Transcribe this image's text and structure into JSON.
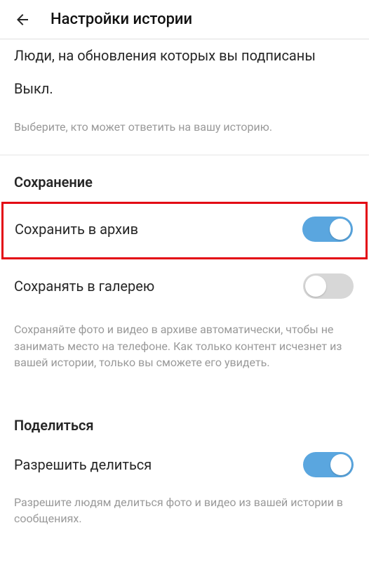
{
  "header": {
    "title": "Настройки истории"
  },
  "replies": {
    "option_followed": "Люди, на обновления которых вы подписаны",
    "off_label": "Выкл.",
    "hint": "Выберите, кто может ответить на вашу историю."
  },
  "saving": {
    "title": "Сохранение",
    "archive_label": "Сохранить в архив",
    "archive_on": true,
    "gallery_label": "Сохранять в галерею",
    "gallery_on": false,
    "hint": "Сохраняйте фото и видео в архиве автоматически, чтобы не занимать место на телефоне. Как только контент исчезнет из вашей истории, только вы сможете его увидеть."
  },
  "sharing": {
    "title": "Поделиться",
    "allow_label": "Разрешить делиться",
    "allow_on": true,
    "hint": "Разрешите людям делиться фото и видео из вашей истории в сообщениях."
  }
}
